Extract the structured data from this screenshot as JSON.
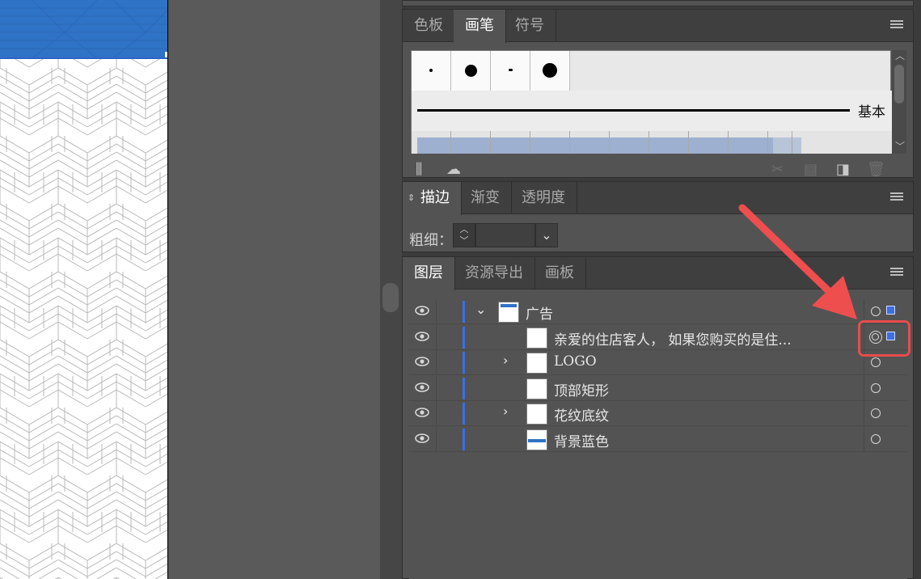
{
  "brush_panel": {
    "tabs": [
      "色板",
      "画笔",
      "符号"
    ],
    "active_tab": "画笔",
    "basic_label": "基本"
  },
  "stroke_panel": {
    "tabs": [
      "描边",
      "渐变",
      "透明度"
    ],
    "active_tab": "描边",
    "weight_label": "粗细：",
    "weight_value": ""
  },
  "layers_panel": {
    "tabs": [
      "图层",
      "资源导出",
      "画板"
    ],
    "active_tab": "图层",
    "rows": [
      {
        "name": "广告",
        "expandable": true,
        "expanded": true,
        "indent": 0,
        "selected": true
      },
      {
        "name": "亲爱的住店客人， 如果您购买的是住...",
        "expandable": false,
        "indent": 1,
        "selected": true,
        "targeted": true
      },
      {
        "name": "LOGO",
        "expandable": true,
        "expanded": false,
        "indent": 1,
        "selected": false
      },
      {
        "name": "顶部矩形",
        "expandable": false,
        "indent": 1,
        "selected": false
      },
      {
        "name": "花纹底纹",
        "expandable": true,
        "expanded": false,
        "indent": 1,
        "selected": false
      },
      {
        "name": "背景蓝色",
        "expandable": false,
        "indent": 1,
        "selected": false
      }
    ]
  },
  "colors": {
    "accent_blue": "#3b6fe6",
    "annotation_red": "#e84c4c",
    "canvas_blue": "#2f73c6"
  }
}
